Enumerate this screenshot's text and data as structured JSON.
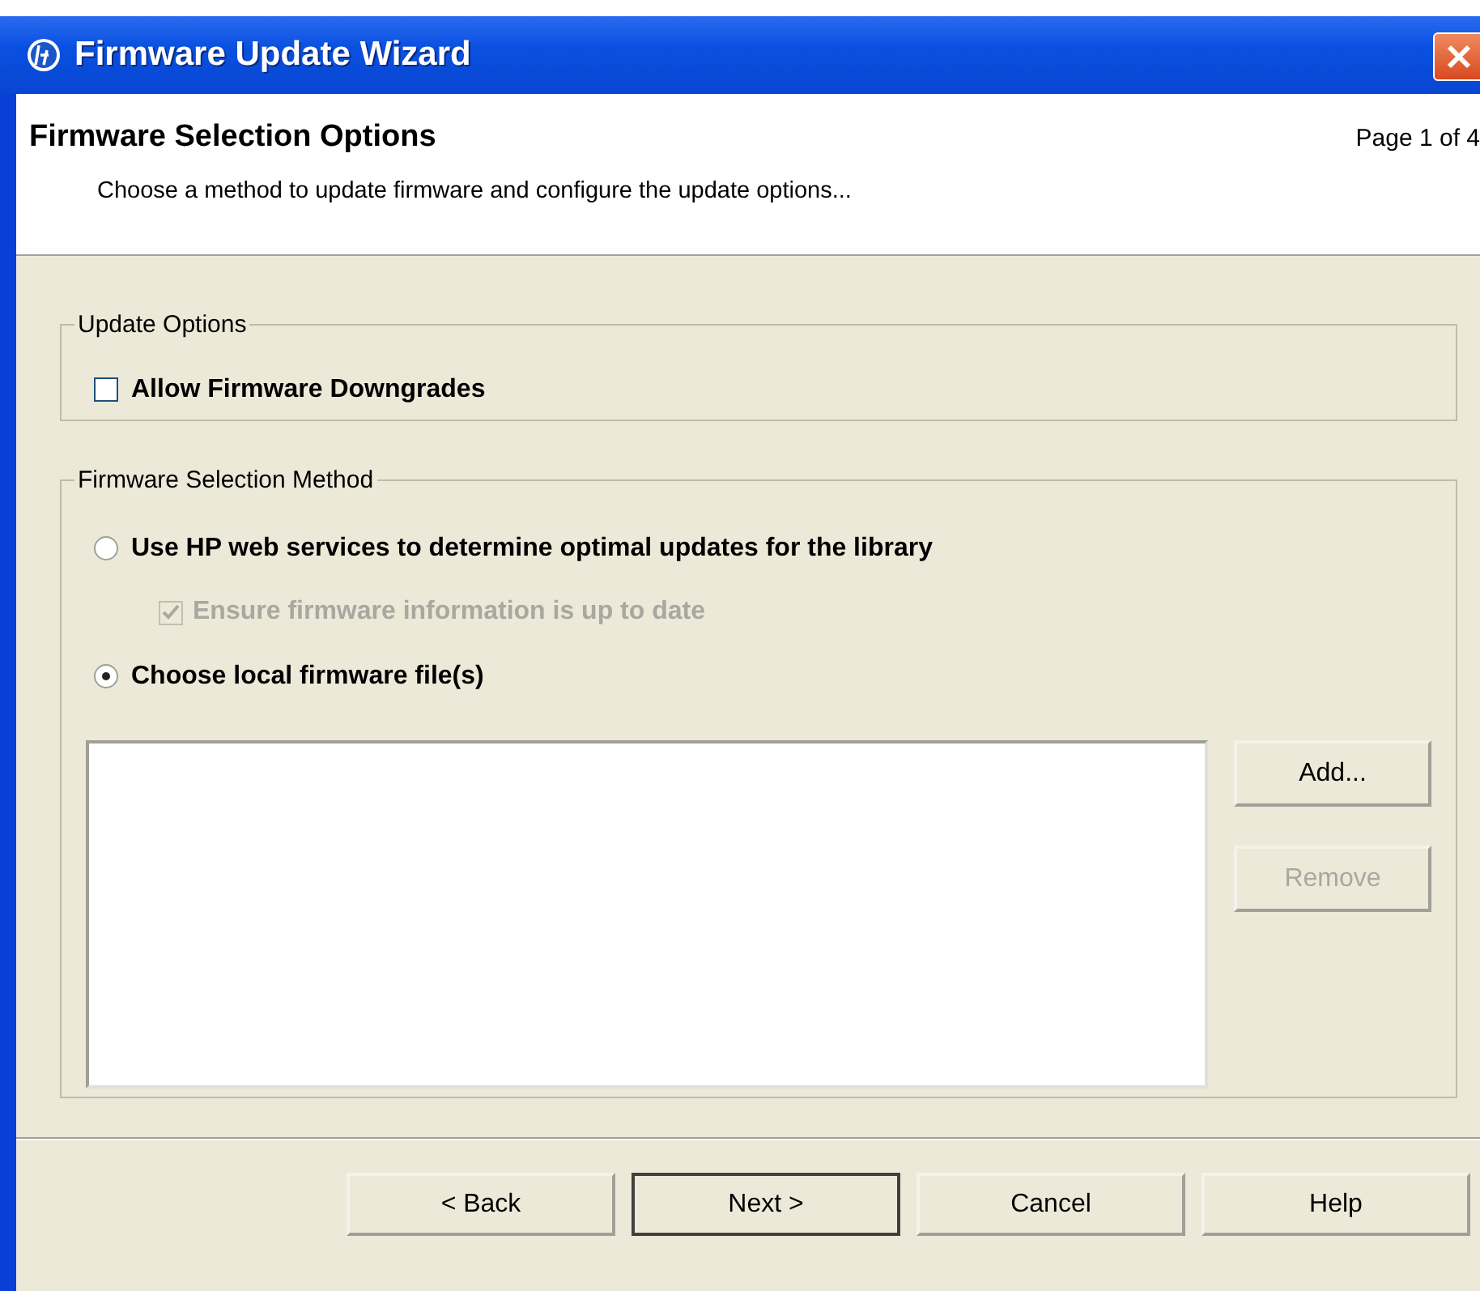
{
  "window": {
    "title": "Firmware Update Wizard"
  },
  "header": {
    "title": "Firmware Selection Options",
    "page": "Page 1 of 4",
    "description": "Choose a method to update firmware and configure the update options..."
  },
  "update_options": {
    "legend": "Update Options",
    "items": [
      {
        "kind": "checkbox",
        "label": "Allow Firmware Downgrades",
        "checked": false,
        "disabled": false
      }
    ]
  },
  "selection_method": {
    "legend": "Firmware Selection Method",
    "items": [
      {
        "kind": "radio",
        "label": "Use HP web services to determine optimal updates for the library",
        "selected": false,
        "disabled": false
      },
      {
        "kind": "checkbox",
        "label": "Ensure firmware information is up to date",
        "checked": true,
        "disabled": true
      },
      {
        "kind": "radio",
        "label": "Choose local firmware file(s)",
        "selected": true,
        "disabled": false
      }
    ],
    "buttons": [
      {
        "label": "Add...",
        "disabled": false
      },
      {
        "label": "Remove",
        "disabled": true
      }
    ]
  },
  "footer_buttons": [
    {
      "label": "< Back",
      "default": false
    },
    {
      "label": "Next >",
      "default": true
    },
    {
      "label": "Cancel",
      "default": false
    },
    {
      "label": "Help",
      "default": false
    }
  ]
}
